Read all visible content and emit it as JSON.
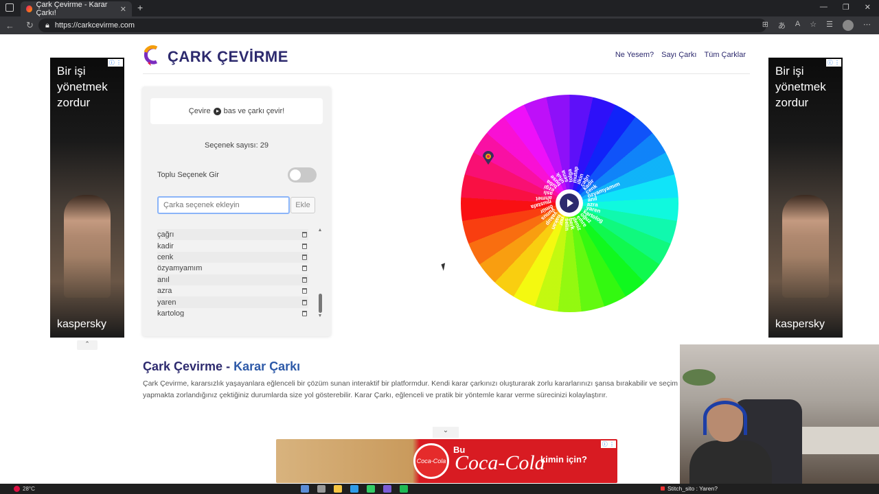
{
  "browser": {
    "tab_title": "Çark Çevirme - Karar Çarkı!",
    "tab_close": "✕",
    "new_tab": "+",
    "url": "https://carkcevirme.com",
    "min": "—",
    "max": "❐",
    "close": "✕"
  },
  "ads": {
    "side_text": "Bir işi yönetmek zordur",
    "side_brand": "kaspersky",
    "adchoice": "ⓘ ⋮",
    "collapse_up": "⌃",
    "collapse_down": "⌄",
    "bottom_bu": "Bu",
    "bottom_brand": "Coca-Cola",
    "bottom_tail": "kimin için?",
    "bottom_disc": "Coca-Cola"
  },
  "header": {
    "logo_text": "ÇARK ÇEVİRME",
    "menu": [
      "Ne Yesem?",
      "Sayı Çarkı",
      "Tüm Çarklar"
    ]
  },
  "panel": {
    "hint_before": "Çevire",
    "hint_after": "bas ve çarkı çevir!",
    "count": "Seçenek sayısı: 29",
    "bulk_label": "Toplu Seçenek Gir",
    "input_placeholder": "Çarka seçenek ekleyin",
    "add_button": "Ekle",
    "items": [
      "çağrı",
      "kadir",
      "cenk",
      "özyamyamım",
      "anıl",
      "azra",
      "yaren",
      "kartolog"
    ],
    "scroll_up": "▲",
    "scroll_down": "▼"
  },
  "wheel": {
    "labels": [
      "mutap",
      "ilkin",
      "çağrı",
      "kadir",
      "cenk",
      "özyamyamım",
      "anıl",
      "azra",
      "yaren",
      "kartolog",
      "oğuz",
      "emre",
      "deniz",
      "berk",
      "selin",
      "nur",
      "hakan",
      "yakup",
      "yunus",
      "ömür",
      "mustafa",
      "ahmet",
      "aslı",
      "ezgi",
      "tuba",
      "buse",
      "ufuk",
      "sena",
      "tolga"
    ]
  },
  "content": {
    "title_a": "Çark Çevirme",
    "title_sep": " - ",
    "title_b": "Karar Çarkı",
    "description": "Çark Çevirme, kararsızlık yaşayanlara eğlenceli bir çözüm sunan interaktif bir platformdur. Kendi karar çarkınızı oluşturarak zorlu kararlarınızı şansa bırakabilir ve seçim yapmakta zorlandığınız çektiğiniz durumlarda size yol gösterebilir. Karar Çarkı, eğlenceli ve pratik bir yöntemle karar verme sürecinizi kolaylaştırır."
  },
  "taskbar": {
    "weather": "28°C",
    "stream_text": "Stitch_sito : Yaren?"
  },
  "colors": {
    "brand": "#2d2a6e",
    "accent": "#2e5aa8"
  }
}
